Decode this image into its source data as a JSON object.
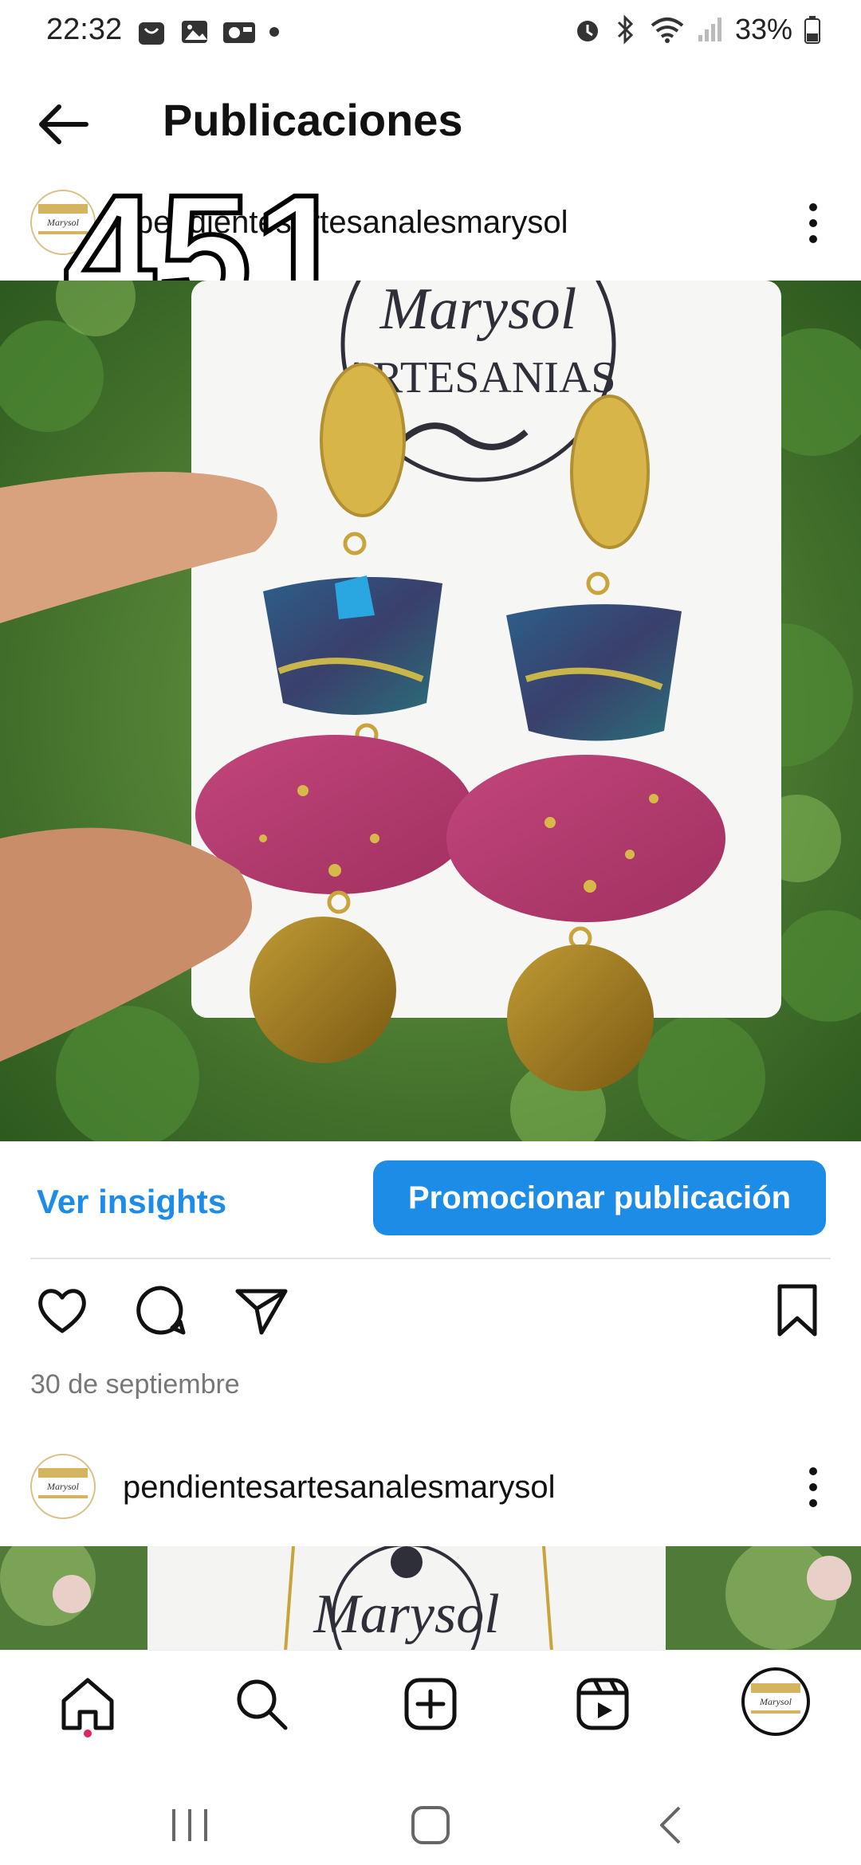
{
  "status_bar": {
    "time": "22:32",
    "battery": "33%",
    "left_icons": [
      "shop-bag-icon",
      "gallery-icon",
      "camera-badge-icon",
      "dot-icon"
    ],
    "right_icons": [
      "alarm-icon",
      "bluetooth-icon",
      "wifi-icon",
      "signal-icon",
      "battery-icon"
    ]
  },
  "header": {
    "title": "Publicaciones",
    "back_icon": "arrow-left-icon"
  },
  "post1": {
    "username": "pendientesartesanalesmarysol",
    "overlay_number": "451",
    "photo_card_text": [
      "Marysol",
      "ARTESANIAS"
    ],
    "ver_insights": "Ver insights",
    "promote_label": "Promocionar publicación",
    "date": "30 de septiembre"
  },
  "post2": {
    "username": "pendientesartesanalesmarysol",
    "photo_card_text": [
      "Marysol"
    ]
  },
  "bottom_nav": {
    "items": [
      "home-icon",
      "search-icon",
      "create-icon",
      "reels-icon",
      "profile-avatar"
    ]
  },
  "colors": {
    "accent": "#1d8ce6",
    "notification_dot": "#e0245e"
  }
}
